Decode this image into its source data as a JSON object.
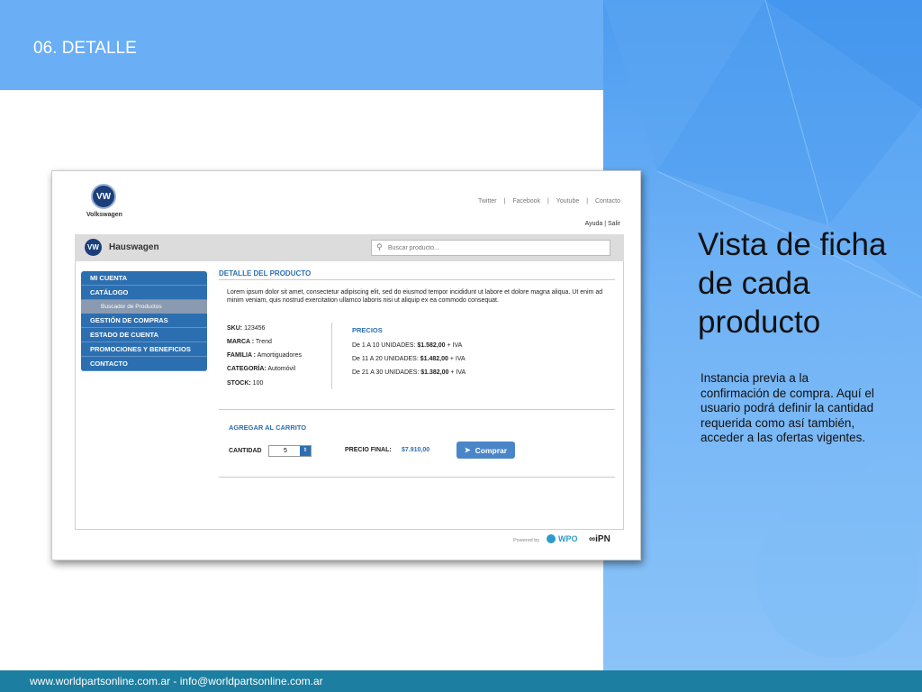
{
  "slide": {
    "section_title": "06. DETALLE",
    "heading": "Vista de ficha de cada producto",
    "description": "Instancia previa a la confirmación de compra. Aquí el usuario podrá definir la cantidad requerida como así también, acceder a las ofertas vigentes.",
    "footer": "www.worldpartsonline.com.ar - info@worldpartsonline.com.ar"
  },
  "app": {
    "brand": "Volkswagen",
    "logo_text": "VW",
    "top_links": [
      "Twitter",
      "Facebook",
      "Youtube",
      "Contacto"
    ],
    "top_link_separator": "|",
    "user_links": "Ayuda | Salir",
    "site_title": "Hauswagen",
    "search_placeholder": "Buscar producto...",
    "nav": {
      "mi_cuenta": "MI CUENTA",
      "catalogo": "CATÁLOGO",
      "buscador": "Buscador de Productos",
      "gestion": "GESTIÓN DE COMPRAS",
      "estado": "ESTADO DE CUENTA",
      "promociones": "PROMOCIONES Y BENEFICIOS",
      "contacto": "CONTACTO"
    },
    "detail": {
      "title": "DETALLE DEL PRODUCTO",
      "lorem": "Lorem ipsum dolor sit amet, consectetur adipiscing elit, sed do eiusmod tempor incididunt ut labore et dolore magna aliqua. Ut enim ad minim veniam, quis nostrud exercitation ullamco laboris nisi ut aliquip ex ea commodo consequat.",
      "sku_label": "SKU:",
      "sku": "123456",
      "marca_label": "MARCA :",
      "marca": "Trend",
      "familia_label": "FAMILIA :",
      "familia": "Amortiguadores",
      "categoria_label": "CATEGORÍA:",
      "categoria": "Automóvil",
      "stock_label": "STOCK:",
      "stock": "100"
    },
    "precios": {
      "title": "PRECIOS",
      "rows": [
        {
          "range": "De 1 A 10 UNIDADES:",
          "price": "$1.582,00",
          "tax": "+ IVA"
        },
        {
          "range": "De 11 A 20 UNIDADES:",
          "price": "$1.482,00",
          "tax": "+ IVA"
        },
        {
          "range": "De 21 A 30 UNIDADES:",
          "price": "$1.382,00",
          "tax": "+ IVA"
        }
      ]
    },
    "cart": {
      "title": "AGREGAR AL CARRITO",
      "qty_label": "CANTIDAD",
      "qty_value": "5",
      "final_label": "PRECIO FINAL:",
      "final_value": "$7.910,00",
      "buy_label": "Comprar"
    },
    "footer": {
      "powered": "Powered by",
      "wpo": "WPO",
      "ipn": "∞iPN"
    }
  },
  "colors": {
    "accent": "#2c6fb1",
    "slide_blue": "#6aaef5",
    "footer_teal": "#1c7ea0"
  }
}
